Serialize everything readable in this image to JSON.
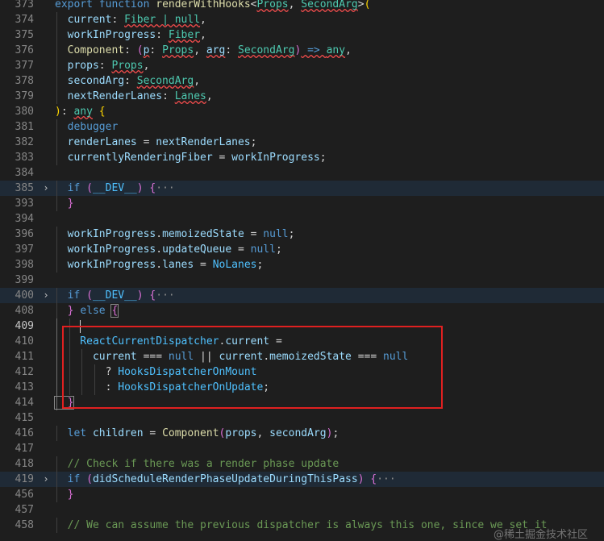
{
  "lines": [
    {
      "n": "373",
      "tokens": [
        [
          "kw",
          "export "
        ],
        [
          "kw",
          "function "
        ],
        [
          "fn",
          "renderWithHooks"
        ],
        [
          "pn",
          "<"
        ],
        [
          "ty squig",
          "Props"
        ],
        [
          "pn",
          ", "
        ],
        [
          "ty squig",
          "SecondArg"
        ],
        [
          "pn",
          ">"
        ],
        [
          "br1",
          "("
        ]
      ]
    },
    {
      "n": "374",
      "tokens": [
        [
          "va",
          "  current"
        ],
        [
          "pn",
          ": "
        ],
        [
          "ty squig",
          "Fiber | null"
        ],
        [
          "pn",
          ","
        ]
      ]
    },
    {
      "n": "375",
      "tokens": [
        [
          "va",
          "  workInProgress"
        ],
        [
          "pn",
          ": "
        ],
        [
          "ty squig",
          "Fiber"
        ],
        [
          "pn",
          ","
        ]
      ]
    },
    {
      "n": "376",
      "tokens": [
        [
          "fn",
          "  Component"
        ],
        [
          "pn",
          ": "
        ],
        [
          "br2",
          "("
        ],
        [
          "va squig",
          "p"
        ],
        [
          "pn",
          ": "
        ],
        [
          "ty squig",
          "Props"
        ],
        [
          "pn",
          ", "
        ],
        [
          "va squig",
          "arg"
        ],
        [
          "pn",
          ": "
        ],
        [
          "ty squig",
          "SecondArg"
        ],
        [
          "br2",
          ")"
        ],
        [
          "kw squig",
          " => "
        ],
        [
          "ty squig",
          "any"
        ],
        [
          "pn",
          ","
        ]
      ]
    },
    {
      "n": "377",
      "tokens": [
        [
          "va",
          "  props"
        ],
        [
          "pn",
          ": "
        ],
        [
          "ty squig",
          "Props"
        ],
        [
          "pn",
          ","
        ]
      ]
    },
    {
      "n": "378",
      "tokens": [
        [
          "va",
          "  secondArg"
        ],
        [
          "pn",
          ": "
        ],
        [
          "ty squig",
          "SecondArg"
        ],
        [
          "pn",
          ","
        ]
      ]
    },
    {
      "n": "379",
      "tokens": [
        [
          "va",
          "  nextRenderLanes"
        ],
        [
          "pn",
          ": "
        ],
        [
          "ty squig",
          "Lanes"
        ],
        [
          "pn",
          ","
        ]
      ]
    },
    {
      "n": "380",
      "tokens": [
        [
          "br1",
          ")"
        ],
        [
          "pn",
          ": "
        ],
        [
          "ty squig",
          "any"
        ],
        [
          "pn",
          " "
        ],
        [
          "br1",
          "{"
        ]
      ]
    },
    {
      "n": "381",
      "tokens": [
        [
          "kw",
          "  debugger"
        ]
      ]
    },
    {
      "n": "382",
      "tokens": [
        [
          "va",
          "  renderLanes"
        ],
        [
          "pn",
          " = "
        ],
        [
          "va",
          "nextRenderLanes"
        ],
        [
          "pn",
          ";"
        ]
      ]
    },
    {
      "n": "383",
      "tokens": [
        [
          "va",
          "  currentlyRenderingFiber"
        ],
        [
          "pn",
          " = "
        ],
        [
          "va",
          "workInProgress"
        ],
        [
          "pn",
          ";"
        ]
      ]
    },
    {
      "n": "384",
      "tokens": []
    },
    {
      "n": "385",
      "fold": true,
      "hl": true,
      "tokens": [
        [
          "kw",
          "  if "
        ],
        [
          "br2",
          "("
        ],
        [
          "cn",
          "__DEV__"
        ],
        [
          "br2",
          ")"
        ],
        [
          "pn",
          " "
        ],
        [
          "br2",
          "{"
        ],
        [
          "ell",
          "···"
        ]
      ]
    },
    {
      "n": "393",
      "tokens": [
        [
          "br2",
          "  }"
        ]
      ]
    },
    {
      "n": "394",
      "tokens": []
    },
    {
      "n": "396",
      "tokens": [
        [
          "va",
          "  workInProgress"
        ],
        [
          "pn",
          "."
        ],
        [
          "va",
          "memoizedState"
        ],
        [
          "pn",
          " = "
        ],
        [
          "kw",
          "null"
        ],
        [
          "pn",
          ";"
        ]
      ]
    },
    {
      "n": "397",
      "tokens": [
        [
          "va",
          "  workInProgress"
        ],
        [
          "pn",
          "."
        ],
        [
          "va",
          "updateQueue"
        ],
        [
          "pn",
          " = "
        ],
        [
          "kw",
          "null"
        ],
        [
          "pn",
          ";"
        ]
      ]
    },
    {
      "n": "398",
      "tokens": [
        [
          "va",
          "  workInProgress"
        ],
        [
          "pn",
          "."
        ],
        [
          "va",
          "lanes"
        ],
        [
          "pn",
          " = "
        ],
        [
          "cn",
          "NoLanes"
        ],
        [
          "pn",
          ";"
        ]
      ]
    },
    {
      "n": "399",
      "tokens": []
    },
    {
      "n": "400",
      "fold": true,
      "hl": true,
      "tokens": [
        [
          "kw",
          "  if "
        ],
        [
          "br2",
          "("
        ],
        [
          "cn",
          "__DEV__"
        ],
        [
          "br2",
          ")"
        ],
        [
          "pn",
          " "
        ],
        [
          "br2",
          "{"
        ],
        [
          "ell",
          "···"
        ]
      ]
    },
    {
      "n": "408",
      "tokens": [
        [
          "br2",
          "  } "
        ],
        [
          "kw",
          "else "
        ],
        [
          "br2 bm",
          "{"
        ]
      ]
    },
    {
      "n": "409",
      "active": true,
      "cursor": true,
      "tokens": []
    },
    {
      "n": "410",
      "tokens": [
        [
          "cn",
          "    ReactCurrentDispatcher"
        ],
        [
          "pn",
          "."
        ],
        [
          "va",
          "current"
        ],
        [
          "pn",
          " ="
        ]
      ]
    },
    {
      "n": "411",
      "tokens": [
        [
          "va",
          "      current"
        ],
        [
          "pn",
          " === "
        ],
        [
          "kw",
          "null"
        ],
        [
          "pn",
          " || "
        ],
        [
          "va",
          "current"
        ],
        [
          "pn",
          "."
        ],
        [
          "va",
          "memoizedState"
        ],
        [
          "pn",
          " === "
        ],
        [
          "kw",
          "null"
        ]
      ]
    },
    {
      "n": "412",
      "tokens": [
        [
          "pn",
          "        ? "
        ],
        [
          "cn",
          "HooksDispatcherOnMount"
        ]
      ]
    },
    {
      "n": "413",
      "tokens": [
        [
          "pn",
          "        : "
        ],
        [
          "cn",
          "HooksDispatcherOnUpdate"
        ],
        [
          "pn",
          ";"
        ]
      ]
    },
    {
      "n": "414",
      "tokens": [
        [
          "br2 bm",
          "  }"
        ]
      ]
    },
    {
      "n": "415",
      "tokens": []
    },
    {
      "n": "416",
      "tokens": [
        [
          "kw",
          "  let "
        ],
        [
          "va",
          "children"
        ],
        [
          "pn",
          " = "
        ],
        [
          "fn",
          "Component"
        ],
        [
          "br2",
          "("
        ],
        [
          "va",
          "props"
        ],
        [
          "pn",
          ", "
        ],
        [
          "va",
          "secondArg"
        ],
        [
          "br2",
          ")"
        ],
        [
          "pn",
          ";"
        ]
      ]
    },
    {
      "n": "417",
      "tokens": []
    },
    {
      "n": "418",
      "tokens": [
        [
          "cm",
          "  // Check if there was a render phase update"
        ]
      ]
    },
    {
      "n": "419",
      "fold": true,
      "hl": true,
      "tokens": [
        [
          "kw",
          "  if "
        ],
        [
          "br2",
          "("
        ],
        [
          "va",
          "didScheduleRenderPhaseUpdateDuringThisPass"
        ],
        [
          "br2",
          ")"
        ],
        [
          "pn",
          " "
        ],
        [
          "br2",
          "{"
        ],
        [
          "ell",
          "···"
        ]
      ]
    },
    {
      "n": "456",
      "tokens": [
        [
          "br2",
          "  }"
        ]
      ]
    },
    {
      "n": "457",
      "tokens": []
    },
    {
      "n": "458",
      "tokens": [
        [
          "cm",
          "  // We can assume the previous dispatcher is always this one, since we set it"
        ]
      ]
    }
  ],
  "watermark": "@稀土掘金技术社区"
}
